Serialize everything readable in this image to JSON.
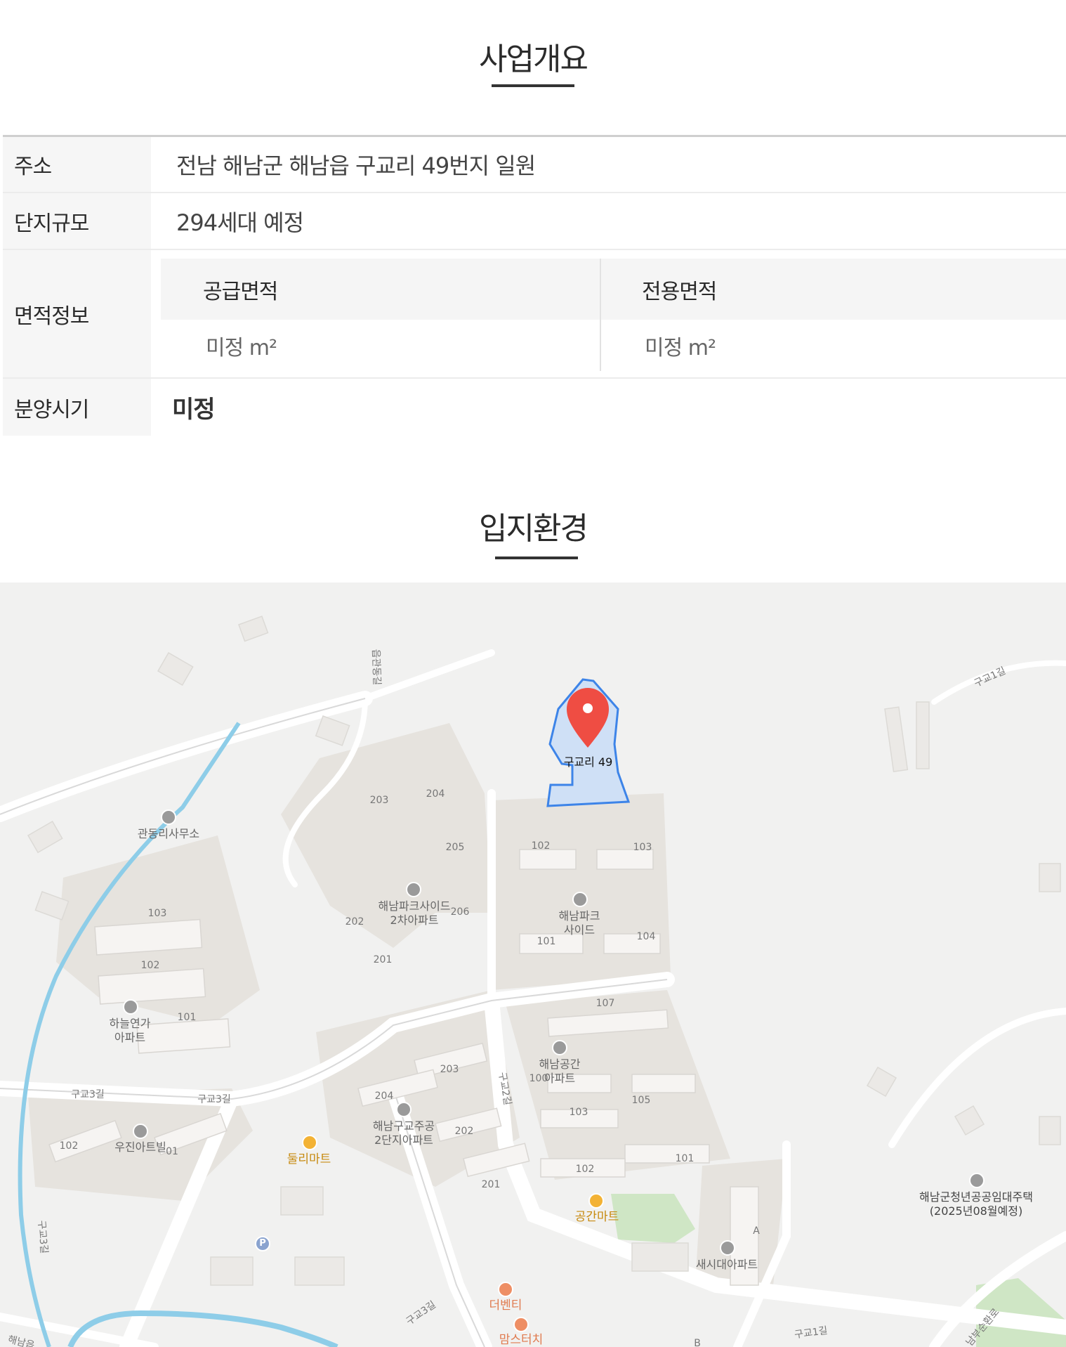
{
  "overview": {
    "title": "사업개요",
    "rows": {
      "address": {
        "label": "주소",
        "value": "전남 해남군 해남읍 구교리 49번지 일원"
      },
      "scale": {
        "label": "단지규모",
        "value": "294세대 예정"
      },
      "area": {
        "label": "면적정보",
        "supply_head": "공급면적",
        "exclusive_head": "전용면적",
        "supply_value": "미정 m²",
        "exclusive_value": "미정 m²"
      },
      "sale": {
        "label": "분양시기",
        "value": "미정"
      }
    }
  },
  "location": {
    "title": "입지환경",
    "map": {
      "marker_label": "구교리 49",
      "labels": {
        "gwandong_office": "관동리사무소",
        "parkside2_a": "해남파크사이드",
        "parkside2_b": "2차아파트",
        "parkside_a": "해남파크",
        "parkside_b": "사이드",
        "haneul_a": "하늘연가",
        "haneul_b": "아파트",
        "gonggan_a": "해남공간",
        "gonggan_b": "아파트",
        "gugyo2_a": "해남구교주공",
        "gugyo2_b": "2단지아파트",
        "woojin": "우진아트빌",
        "dulli_mart": "둘리마트",
        "gonggan_mart": "공간마트",
        "saesidae": "새시대아파트",
        "youth_a": "해남군청년공공임대주택",
        "youth_b": "(2025년08월예정)",
        "the_benti": "더벤티",
        "massdak": "맘스터치",
        "road_gugyo1_top": "구교1길",
        "road_gugyo1_bottom": "구교1길",
        "road_gugyo2": "구교2길",
        "road_gugyo3_a": "구교3길",
        "road_gugyo3_b": "구교3길",
        "road_gugyo3_c": "구교3길",
        "road_gugyo3_d": "구교3길",
        "road_gwandong": "읍관동길",
        "road_bottom_right": "남부순환로",
        "road_bottom_left": "해남읍",
        "parking": "P"
      },
      "building_numbers": {
        "b203a": "203",
        "b204a": "204",
        "b205": "205",
        "b202a": "202",
        "b206": "206",
        "b201a": "201",
        "b102a": "102",
        "b103a": "103",
        "b101a": "101",
        "b104": "104",
        "b103h": "103",
        "b102h": "102",
        "b101h": "101",
        "b107": "107",
        "b100": "100",
        "b105": "105",
        "b103g": "103",
        "b102g": "102",
        "b101g": "101",
        "b203b": "203",
        "b204b": "204",
        "b202b": "202",
        "b201b": "201",
        "b102w": "102",
        "b01w": "01",
        "bA": "A",
        "bB": "B"
      }
    }
  }
}
